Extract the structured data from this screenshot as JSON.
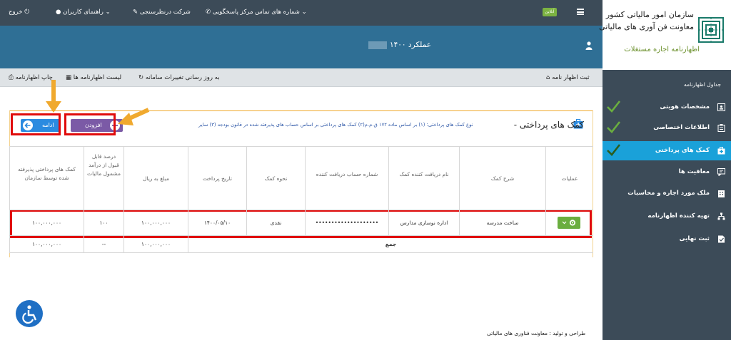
{
  "topbar": {
    "logout": "خروج",
    "user_guide": "راهنمای کاربران",
    "survey": "شرکت درنظرسنجی",
    "contact_numbers": "شماره های تماس مرکز پاسخگویی",
    "online_badge": "آنلاین"
  },
  "header": {
    "performance_label": "عملکرد ۱۴۰۰"
  },
  "toolbar": {
    "print_declaration": "چاپ اظهارنامه",
    "declarations_list": "لیست اظهارنامه ها",
    "system_updates": "به روز رسانی تغییرات سامانه",
    "register_declaration": "ثبت اظهار نامه"
  },
  "sidebar": {
    "org_line1": "سازمان امور مالیاتی کشور",
    "org_line2": "معاونت فن آوری های مالیاتی",
    "subtitle": "اظهارنامه اجاره مستغلات",
    "heading": "جداول اظهارنامه",
    "items": [
      {
        "label": "مشخصات هویتی",
        "checked": true
      },
      {
        "label": "اطلاعات اختصاصی",
        "checked": true
      },
      {
        "label": "کمک های پرداختی",
        "checked": true,
        "active": true
      },
      {
        "label": "معافیت ها",
        "checked": false
      },
      {
        "label": "ملک مورد اجاره و محاسبات",
        "checked": false
      },
      {
        "label": "تهیه کننده اظهارنامه",
        "checked": false
      },
      {
        "label": "ثبت نهایی",
        "checked": false
      }
    ]
  },
  "panel": {
    "title": "کمک های پرداختی -",
    "note": "نوع کمک های پرداختی: (۱) بر اساس ماده ۱۷۲ ق.م.م(۲) کمک های پرداختی بر اساس حساب های پذیرفته شده در قانون بودجه (۳) سایر",
    "add_button": "افزودن",
    "continue_button": "ادامه"
  },
  "table": {
    "headers": [
      "عملیات",
      "شرح کمک",
      "نام دریافت کننده کمک",
      "شماره حساب دریافت کننده",
      "نحوه کمک",
      "تاریخ پرداخت",
      "مبلغ به ریال",
      "درصد قابل قبول از درآمد مشمول مالیات",
      "کمک های پرداختی پذیرفته شده توسط سازمان"
    ],
    "row": {
      "description": "ساخت مدرسه",
      "recipient": "اداره نوسازی مدارس",
      "account": "••••••••••••••••••••",
      "method": "نقدی",
      "date": "۱۴۰۰/۰۵/۱۰",
      "amount": "۱۰۰,۰۰۰,۰۰۰",
      "percent": "۱۰۰",
      "accepted": "۱۰۰,۰۰۰,۰۰۰"
    },
    "total": {
      "label": "جمع",
      "amount": "۱۰۰,۰۰۰,۰۰۰",
      "percent": "--",
      "accepted": "۱۰۰,۰۰۰,۰۰۰"
    }
  },
  "footer": {
    "credit": "طراحی و تولید : معاونت فناوری های مالیاتی"
  },
  "colors": {
    "topbar": "#3c4b58",
    "band": "#2f6f95",
    "sidebar_active": "#1aa1d9",
    "check": "#6aae3f",
    "highlight": "#e00b0b",
    "arrow": "#f0a92e"
  }
}
